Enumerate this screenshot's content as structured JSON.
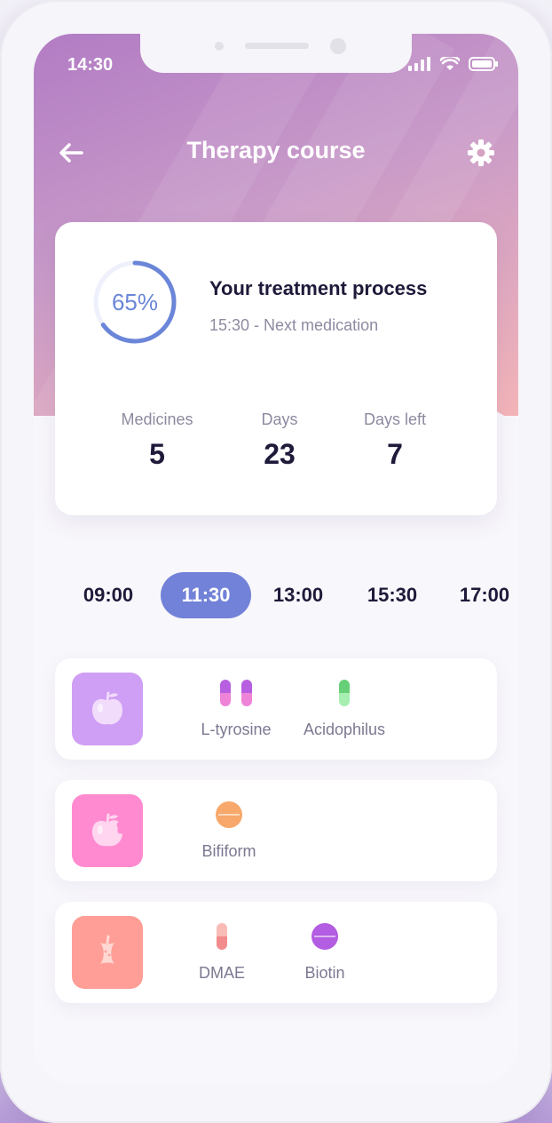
{
  "status_bar": {
    "time": "14:30"
  },
  "nav": {
    "title": "Therapy course",
    "back_icon": "arrow-left-icon",
    "settings_icon": "gear-icon"
  },
  "summary": {
    "progress_percent": 65,
    "progress_label": "65%",
    "title": "Your treatment process",
    "subtitle": "15:30 - Next medication",
    "stats": [
      {
        "label": "Medicines",
        "value": "5"
      },
      {
        "label": "Days",
        "value": "23"
      },
      {
        "label": "Days left",
        "value": "7"
      }
    ]
  },
  "times": [
    "09:00",
    "11:30",
    "13:00",
    "15:30",
    "17:00"
  ],
  "selected_time": "11:30",
  "schedule": [
    {
      "food_icon": "apple-icon",
      "tile_color": "#cf9ef5",
      "meds": [
        {
          "name": "L-tyrosine",
          "icon": "capsule-pair-icon",
          "color": "#c470e6"
        },
        {
          "name": "Acidophilus",
          "icon": "capsule-icon",
          "color": "#79d98b"
        }
      ]
    },
    {
      "food_icon": "bitten-apple-icon",
      "tile_color": "#ff8ad0",
      "meds": [
        {
          "name": "Bifiform",
          "icon": "round-pill-icon",
          "color": "#f7a86a"
        }
      ]
    },
    {
      "food_icon": "apple-core-icon",
      "tile_color": "#ff9e96",
      "meds": [
        {
          "name": "DMAE",
          "icon": "capsule-icon",
          "color": "#f28b8b"
        },
        {
          "name": "Biotin",
          "icon": "round-pill-icon",
          "color": "#b35de2"
        }
      ]
    }
  ]
}
